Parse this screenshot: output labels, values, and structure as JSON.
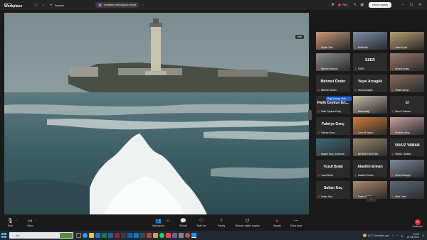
{
  "titlebar": {
    "logo_small": "zoom",
    "logo_big": "Workplace",
    "meeting_title": "Toplantı",
    "room_label": "izmirlikler ailik ikiyüzü ekrani",
    "rec_label": "REC",
    "share_label": "Ekranı paylaş"
  },
  "main_video": {
    "corner_button": "Ileri"
  },
  "gallery": {
    "tiles": [
      {
        "name": "Nejdet Zöle",
        "type": "photo",
        "color": "#c99a7a"
      },
      {
        "name": "Refia Bilir",
        "type": "photo",
        "color": "#7a8fa8"
      },
      {
        "name": "Latife Erçek",
        "type": "photo",
        "color": "#b5a070"
      },
      {
        "name": "Mehmet Bozkurt",
        "type": "photo",
        "color": "#8d8d8d"
      },
      {
        "name": "ESER",
        "type": "text",
        "big": "ESER"
      },
      {
        "name": "Nevzat Arslan",
        "type": "photo",
        "color": "#9a7a6a"
      },
      {
        "name": "Mehmet Önder",
        "type": "text",
        "big": "Mehmet Önder"
      },
      {
        "name": "Veysi Arcagök",
        "type": "text",
        "big": "Veysi Arcagök"
      },
      {
        "name": "Yüksel Ipekçi",
        "type": "photo",
        "color": "#8a6a5a"
      },
      {
        "name": "Fatih Ceykun Ertaş",
        "type": "text",
        "big": "Fatih Ceykun Ert..."
      },
      {
        "name": "Bozkurtdiği",
        "type": "photo",
        "color": "#c8b8a8"
      },
      {
        "name": "Taner Turkman",
        "type": "text",
        "big": "ûl"
      },
      {
        "name": "Fahriye Genç",
        "type": "text",
        "big": "Fahriye Genç"
      },
      {
        "name": "Cem Ali Yazıcı",
        "type": "photo",
        "color": "#d07a3a"
      },
      {
        "name": "Neslihan Alkış",
        "type": "photo",
        "color": "#caa0a0"
      },
      {
        "name": "Kaşam Ekçi, (bir)Nural",
        "type": "photo",
        "color": "#3a6a7a"
      },
      {
        "name": "MEHMET BAYSAN",
        "type": "photo",
        "color": "#9a8a6a"
      },
      {
        "name": "YAVUZ YAMAN",
        "type": "text",
        "big": "YAVUZ YAMAN"
      },
      {
        "name": "Yusuf Bulat",
        "type": "text",
        "big": "Yusuf Bulat"
      },
      {
        "name": "Alaettin Erman",
        "type": "text",
        "big": "Alaettin Erman"
      },
      {
        "name": "Cihat Kirlikoğlu",
        "type": "photo",
        "color": "#7a8a9a"
      },
      {
        "name": "Sultan Koç",
        "type": "text",
        "big": "Sultan Koç"
      },
      {
        "name": "Emine ÇETİN",
        "type": "photo",
        "color": "#b08a6a"
      },
      {
        "name": "Sibel Tutat",
        "type": "photo",
        "color": "#5a6a7a"
      }
    ],
    "highlight_label": "Bilgi Kumaşı Ekle"
  },
  "controls": {
    "mute": "Sesi",
    "video": "Video",
    "participants": "Katılımcılar",
    "participants_count": "43",
    "chat": "Sohbet",
    "react": "Tepki ver",
    "share": "Paylaş",
    "apps": "Otomom sahibi araçları",
    "record": "Kaydet",
    "more": "Daha fazla",
    "end": "Sonlandır"
  },
  "taskbar": {
    "search_placeholder": "Ara",
    "weather": "11°C  Genellikle açık",
    "time": "21:05",
    "date": "21.04.2024"
  }
}
